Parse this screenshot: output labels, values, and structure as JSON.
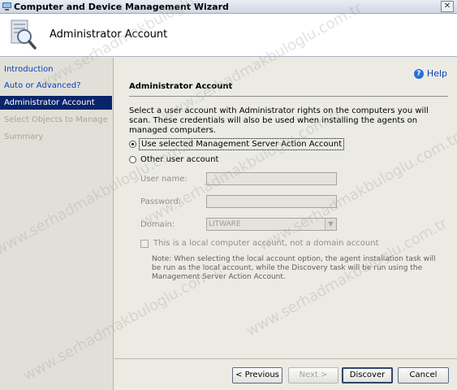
{
  "window": {
    "title": "Computer and Device Management Wizard",
    "close_glyph": "✕"
  },
  "header": {
    "title": "Administrator Account",
    "icon": "magnifier-computer-icon"
  },
  "nav": {
    "items": [
      {
        "label": "Introduction",
        "state": "link"
      },
      {
        "label": "Auto or Advanced?",
        "state": "link"
      },
      {
        "label": "Administrator Account",
        "state": "current"
      },
      {
        "label": "Select Objects to Manage",
        "state": "disabled"
      },
      {
        "label": "Summary",
        "state": "disabled"
      }
    ]
  },
  "main": {
    "help_label": "Help",
    "section_title": "Administrator Account",
    "description": "Select a user account with Administrator rights on the computers you will scan. These credentials will also be used when installing the agents on managed computers.",
    "options": [
      {
        "label": "Use selected Management Server Action Account",
        "checked": true
      },
      {
        "label": "Other user account",
        "checked": false
      }
    ],
    "fields": {
      "username_label": "User name:",
      "username_value": "",
      "password_label": "Password:",
      "password_value": "",
      "domain_label": "Domain:",
      "domain_value": "LITWARE"
    },
    "local_account_label": "This is a local computer account, not a domain account",
    "local_account_checked": false,
    "note": "Note:  When selecting the local account option, the agent installation task will be run as the local account, while the Discovery task will be run using the Management Server Action Account."
  },
  "footer": {
    "previous": "< Previous",
    "next": "Next >",
    "discover": "Discover",
    "cancel": "Cancel"
  },
  "watermark": {
    "text": "www.serhadmakbuloglu.com.tr"
  },
  "colors": {
    "nav_selected": "#0a246a",
    "link": "#0a3fb8"
  }
}
